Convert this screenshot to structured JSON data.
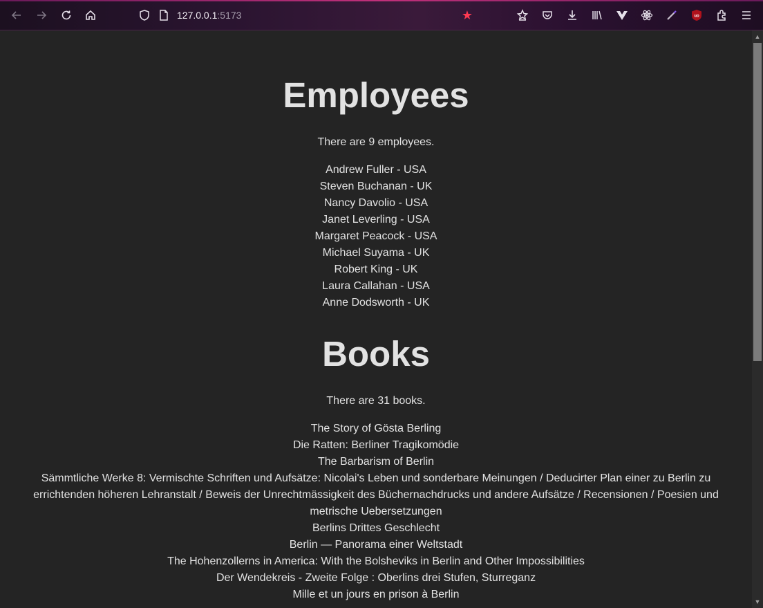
{
  "browser": {
    "url_host": "127.0.0.1",
    "url_port": ":5173",
    "icons": [
      "back-icon",
      "forward-icon",
      "reload-icon",
      "home-icon",
      "shield-icon",
      "page-icon",
      "bookmark-star-icon",
      "pocket-save-icon",
      "pocket-icon",
      "download-icon",
      "library-icon",
      "vue-devtools-icon",
      "react-devtools-icon",
      "color-picker-icon",
      "ublock-icon",
      "extensions-icon",
      "menu-icon"
    ]
  },
  "employees": {
    "heading": "Employees",
    "count_text": "There are 9 employees.",
    "items": [
      "Andrew Fuller - USA",
      "Steven Buchanan - UK",
      "Nancy Davolio - USA",
      "Janet Leverling - USA",
      "Margaret Peacock - USA",
      "Michael Suyama - UK",
      "Robert King - UK",
      "Laura Callahan - USA",
      "Anne Dodsworth - UK"
    ]
  },
  "books": {
    "heading": "Books",
    "count_text": "There are 31 books.",
    "items": [
      "The Story of Gösta Berling",
      "Die Ratten: Berliner Tragikomödie",
      "The Barbarism of Berlin",
      "Sämmtliche Werke 8: Vermischte Schriften und Aufsätze: Nicolai's Leben und sonderbare Meinungen / Deducirter Plan einer zu Berlin zu errichtenden höheren Lehranstalt / Beweis der Unrechtmässigkeit des Büchernachdrucks und andere Aufsätze / Recensionen / Poesien und metrische Uebersetzungen",
      "Berlins Drittes Geschlecht",
      "Berlin — Panorama einer Weltstadt",
      "The Hohenzollerns in America: With the Bolsheviks in Berlin and Other Impossibilities",
      "Der Wendekreis - Zweite Folge : Oberlins drei Stufen, Sturreganz",
      "Mille et un jours en prison à Berlin"
    ]
  }
}
